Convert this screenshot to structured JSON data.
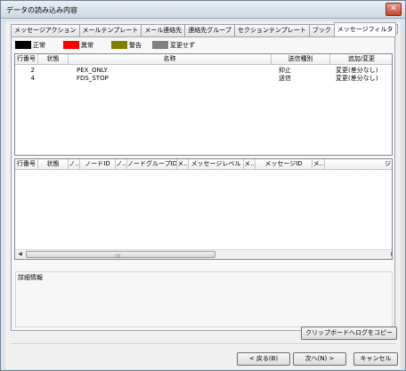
{
  "window": {
    "title": "データの読み込み内容",
    "close_label": "✕"
  },
  "tabs": [
    "メッセージアクション",
    "メールテンプレート",
    "メール連絡先",
    "連絡先グループ",
    "セクションテンプレート",
    "ブック",
    "メッセージフィルタ"
  ],
  "tab_scroll": {
    "left": "◂",
    "right": "▸"
  },
  "legend": [
    {
      "color": "#000000",
      "label": "正常"
    },
    {
      "color": "#ff0000",
      "label": "異常"
    },
    {
      "color": "#808000",
      "label": "警告"
    },
    {
      "color": "#808080",
      "label": "変更せず"
    }
  ],
  "filter_grid": {
    "headers": [
      "行番号",
      "状態",
      "名称",
      "送信種別",
      "追加/変更"
    ],
    "rows": [
      {
        "no": "2",
        "status": "",
        "name": "PEX_ONLY",
        "send_type": "抑止",
        "change": "変更(差分なし)"
      },
      {
        "no": "4",
        "status": "",
        "name": "FDS_STOP",
        "send_type": "送信",
        "change": "変更(差分なし)"
      }
    ]
  },
  "detail_grid": {
    "headers": [
      "行番号",
      "状態",
      "ノ..",
      "ノードID",
      "ノ..",
      "ノードグループID",
      "メ..",
      "メッセージレベル",
      "メ..",
      "メッセージID",
      "メ..",
      "ジ"
    ]
  },
  "details": {
    "label": "詳細情報"
  },
  "buttons": {
    "copy": "クリップボードへログをコピー",
    "back": "< 戻る(B)",
    "next": "次へ(N) >",
    "cancel": "キャンセル"
  }
}
